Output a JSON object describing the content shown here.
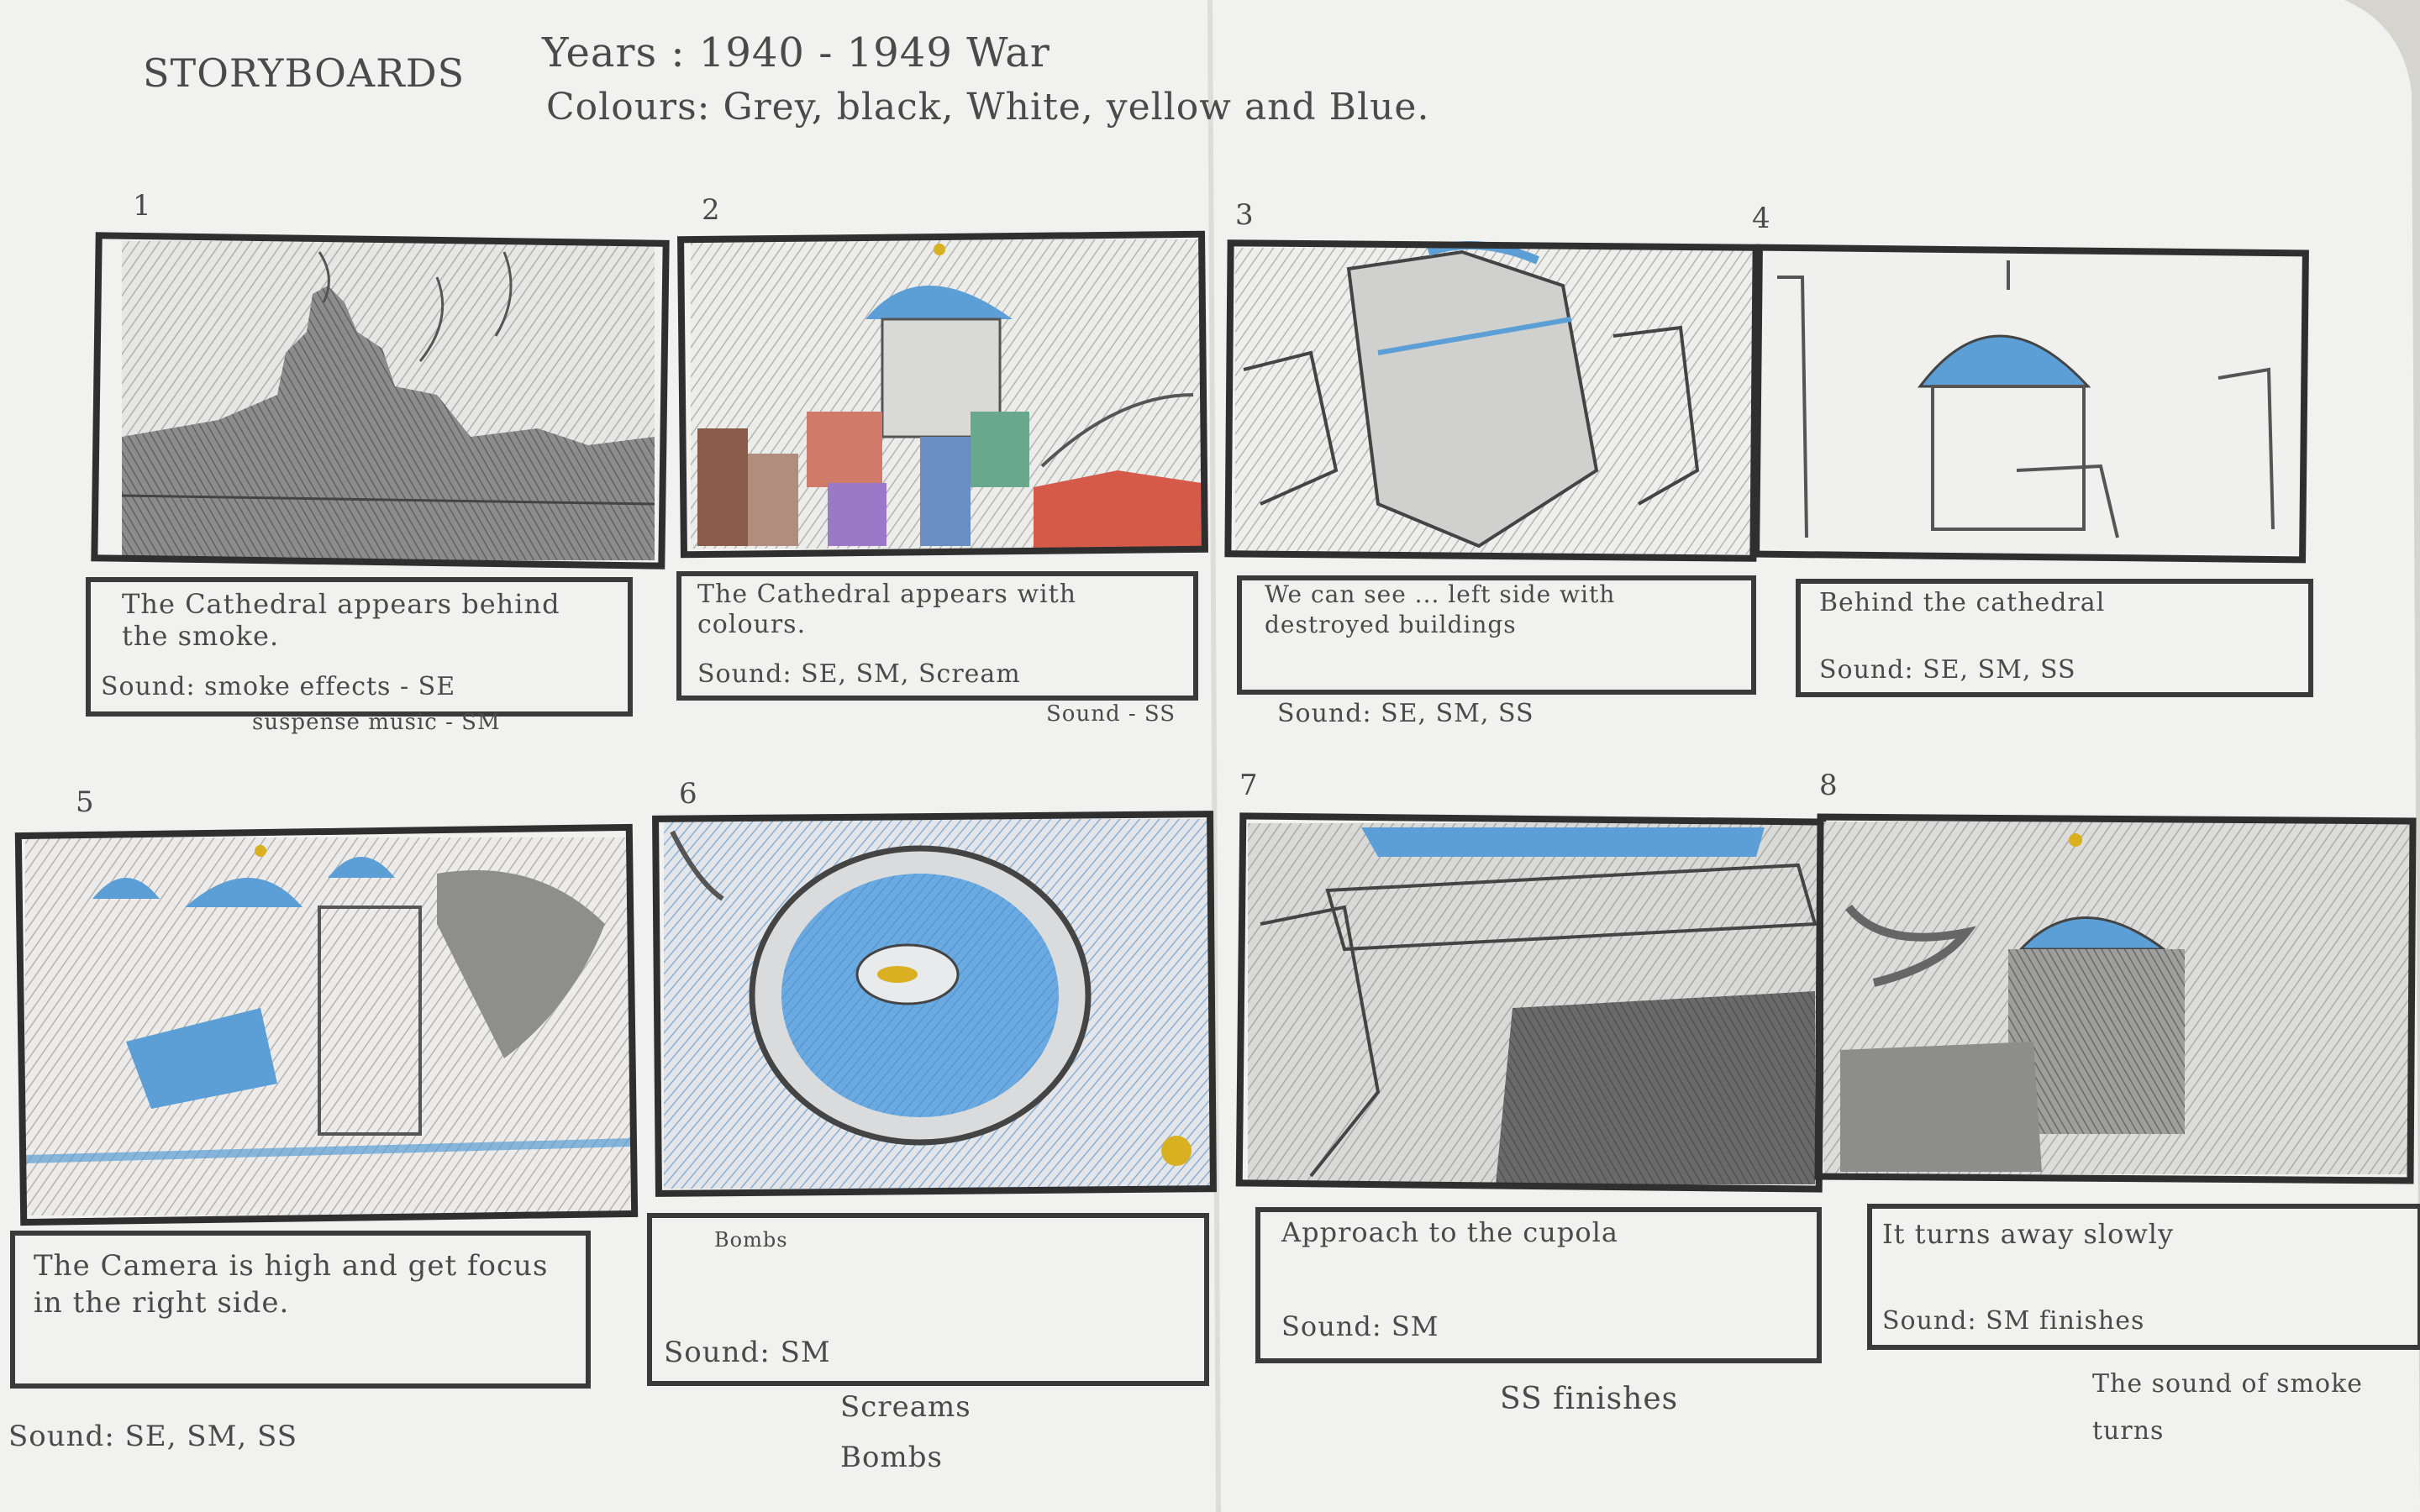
{
  "header": {
    "title": "STORYBOARDS",
    "years": "Years : 1940 - 1949 War",
    "colours": "Colours: Grey, black, White, yellow and Blue."
  },
  "panels": [
    {
      "number": "1",
      "caption": "The Cathedral appears behind the smoke.",
      "sound": "Sound: smoke effects - SE",
      "extra": "suspense music - SM"
    },
    {
      "number": "2",
      "caption": "The Cathedral appears with colours.",
      "sound": "Sound: SE, SM, Scream",
      "extra": "Sound - SS"
    },
    {
      "number": "3",
      "caption": "We can see ... left side with destroyed buildings",
      "sound": "",
      "extra": "Sound: SE, SM, SS"
    },
    {
      "number": "4",
      "caption": "Behind the cathedral",
      "sound": "Sound: SE, SM, SS",
      "extra": ""
    },
    {
      "number": "5",
      "caption": "The Camera is high and get focus in the right side.",
      "sound": "",
      "extra": "Sound: SE, SM, SS"
    },
    {
      "number": "6",
      "caption": "Bombs",
      "sound": "Sound: SM",
      "extra": "Screams Bombs"
    },
    {
      "number": "7",
      "caption": "Approach to the cupola",
      "sound": "Sound: SM",
      "extra": "SS finishes"
    },
    {
      "number": "8",
      "caption": "It turns away slowly",
      "sound": "Sound: SM finishes",
      "extra": "The sound of smoke turns"
    }
  ],
  "colors": {
    "paper": "#f1f1ef",
    "pencil": "#4a4a4a",
    "dome_blue": "#5b9fd6",
    "gold": "#d8b020"
  }
}
